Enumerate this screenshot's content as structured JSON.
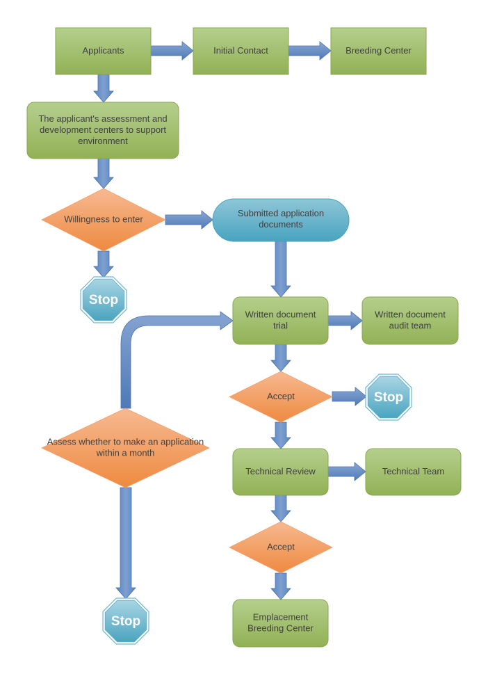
{
  "diagram": {
    "type": "flowchart",
    "colors": {
      "process_fill_top": "#b3cd8a",
      "process_fill_bottom": "#92b156",
      "process_stroke": "#7f9e4a",
      "decision_fill_top": "#f6b58c",
      "decision_fill_bottom": "#ee8c44",
      "terminal_fill_top": "#8cc4d6",
      "terminal_fill_bottom": "#4aa6c0",
      "terminal_stroke": "#3f95ad",
      "stop_fill_top": "#a8d4e2",
      "stop_fill_bottom": "#49a3bf",
      "arrow_fill_top": "#8aa6d2",
      "arrow_fill_bottom": "#4f7bb8",
      "arrow_stroke": "#4a72ab"
    },
    "nodes": {
      "applicants": {
        "lines": [
          "Applicants"
        ],
        "shape": "rectangle"
      },
      "initial_contact": {
        "lines": [
          "Initial Contact"
        ],
        "shape": "rectangle"
      },
      "breeding_center": {
        "lines": [
          "Breeding Center"
        ],
        "shape": "rectangle"
      },
      "assessment": {
        "lines": [
          "The applicant's assessment and",
          "development centers to support",
          "environment"
        ],
        "shape": "rounded-rectangle"
      },
      "willingness": {
        "lines": [
          "Willingness to enter"
        ],
        "shape": "diamond"
      },
      "stop1": {
        "lines": [
          "Stop"
        ],
        "shape": "octagon"
      },
      "submitted": {
        "lines": [
          "Submitted application",
          "documents"
        ],
        "shape": "terminal"
      },
      "written_trial": {
        "lines": [
          "Written document",
          "trial"
        ],
        "shape": "rounded-rectangle"
      },
      "audit_team": {
        "lines": [
          "Written document",
          "audit team"
        ],
        "shape": "rounded-rectangle"
      },
      "accept1": {
        "lines": [
          "Accept"
        ],
        "shape": "diamond"
      },
      "stop2": {
        "lines": [
          "Stop"
        ],
        "shape": "octagon"
      },
      "assess_month": {
        "lines": [
          "Assess whether to make an application",
          "within a month"
        ],
        "shape": "diamond"
      },
      "technical_review": {
        "lines": [
          "Technical Review"
        ],
        "shape": "rounded-rectangle"
      },
      "technical_team": {
        "lines": [
          "Technical Team"
        ],
        "shape": "rounded-rectangle"
      },
      "accept2": {
        "lines": [
          "Accept"
        ],
        "shape": "diamond"
      },
      "emplacement": {
        "lines": [
          "Emplacement",
          "Breeding Center"
        ],
        "shape": "rounded-rectangle"
      },
      "stop3": {
        "lines": [
          "Stop"
        ],
        "shape": "octagon"
      }
    },
    "edges": [
      {
        "from": "applicants",
        "to": "initial_contact"
      },
      {
        "from": "initial_contact",
        "to": "breeding_center"
      },
      {
        "from": "applicants",
        "to": "assessment"
      },
      {
        "from": "assessment",
        "to": "willingness"
      },
      {
        "from": "willingness",
        "to": "submitted"
      },
      {
        "from": "willingness",
        "to": "stop1"
      },
      {
        "from": "submitted",
        "to": "written_trial"
      },
      {
        "from": "written_trial",
        "to": "audit_team"
      },
      {
        "from": "written_trial",
        "to": "accept1"
      },
      {
        "from": "accept1",
        "to": "stop2"
      },
      {
        "from": "accept1",
        "to": "technical_review"
      },
      {
        "from": "assess_month",
        "to": "written_trial"
      },
      {
        "from": "assess_month",
        "to": "stop3"
      },
      {
        "from": "technical_review",
        "to": "technical_team"
      },
      {
        "from": "technical_review",
        "to": "accept2"
      },
      {
        "from": "accept2",
        "to": "emplacement"
      }
    ]
  }
}
